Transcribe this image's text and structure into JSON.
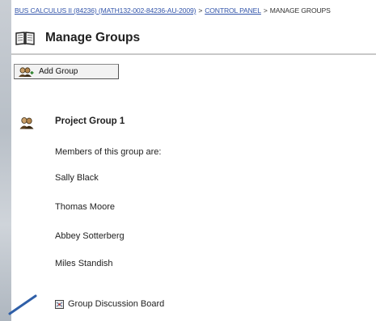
{
  "breadcrumb": {
    "course_link": "BUS CALCULUS II (84236) (MATH132-002-84236-AU-2009)",
    "sep1": ">",
    "control_panel_link": "CONTROL PANEL",
    "sep2": ">",
    "current": "MANAGE GROUPS"
  },
  "page": {
    "title": "Manage Groups"
  },
  "toolbar": {
    "add_group_label": "Add Group"
  },
  "group": {
    "name": "Project Group 1",
    "members_heading": "Members of this group are:",
    "members": [
      "Sally Black",
      "Thomas Moore",
      "Abbey Sotterberg",
      "Miles Standish"
    ],
    "discussion_label": "Group Discussion Board"
  },
  "colors": {
    "link": "#3355aa",
    "arrow": "#2f5fa8",
    "divider": "#c8c8c8"
  },
  "icons": {
    "title": "book-icon",
    "add_group": "add-group-icon",
    "group": "group-icon",
    "discussion": "discussion-board-icon"
  }
}
